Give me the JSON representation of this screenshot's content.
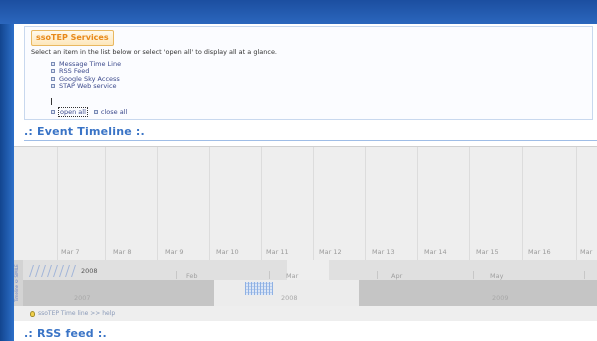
{
  "services": {
    "title": "ssoTEP Services",
    "intro": "Select an item in the list below or select 'open all' to display all at a glance.",
    "items": [
      "Message Time Line",
      "RSS Feed",
      "Google Sky Access",
      "STAP Web service"
    ],
    "open_all": "open all",
    "close_all": "close all"
  },
  "event_timeline": {
    "header": ".: Event Timeline :.",
    "day_labels": [
      "Mar 7",
      "Mar 8",
      "Mar 9",
      "Mar 10",
      "Mar 11",
      "Mar 12",
      "Mar 13",
      "Mar 14",
      "Mar 15",
      "Mar 16",
      "Mar"
    ],
    "month_labels": [
      "2008",
      "Feb",
      "Mar",
      "Apr",
      "May"
    ],
    "overview_labels": [
      "2007",
      "2008",
      "2009"
    ],
    "side_label": "Timeline © SIMILE"
  },
  "help_text": "ssoTEP Time line >> help",
  "rss": {
    "header": ".: RSS feed :."
  }
}
